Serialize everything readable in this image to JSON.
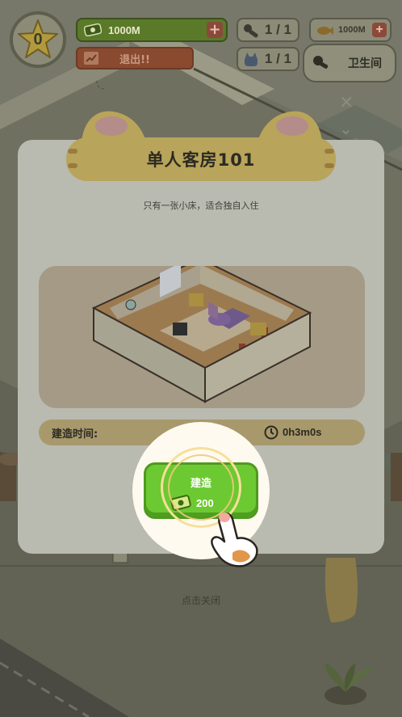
{
  "hud": {
    "level": "0",
    "cash": "1000M",
    "exit_label": "退出!!",
    "stat_a": "1 / 1",
    "stat_b": "1 / 1",
    "gold": "1000M",
    "room_label": "卫生间"
  },
  "modal": {
    "title": "单人客房101",
    "description": "只有一张小床，适合独自入住",
    "build_time_label": "建造时间:",
    "build_time_value": "0h3m0s",
    "build_button_label": "建造",
    "build_cost": "200",
    "close_hint": "点击关闭"
  },
  "colors": {
    "accent_green": "#6cc932",
    "banner_yellow": "#b8a45a",
    "modal_bg": "#b9bab0"
  }
}
